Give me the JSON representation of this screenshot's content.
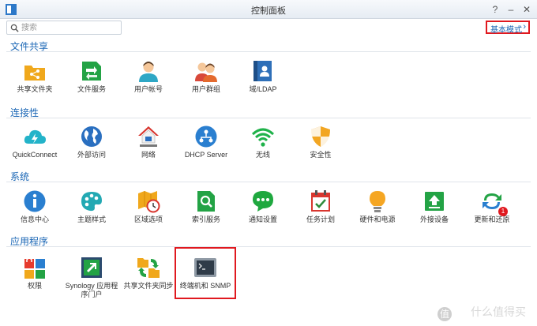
{
  "window": {
    "title": "控制面板",
    "help": "?",
    "minimize": "–",
    "close": "✕"
  },
  "search": {
    "placeholder": "搜索"
  },
  "mode_button": {
    "label": "基本模式",
    "chevron": "›"
  },
  "sections": [
    {
      "title": "文件共享",
      "items": [
        {
          "label": "共享文件夹",
          "icon": "share-folder-icon"
        },
        {
          "label": "文件服务",
          "icon": "file-services-icon"
        },
        {
          "label": "用户帐号",
          "icon": "user-icon"
        },
        {
          "label": "用户群组",
          "icon": "group-icon"
        },
        {
          "label": "域/LDAP",
          "icon": "ldap-icon"
        }
      ]
    },
    {
      "title": "连接性",
      "items": [
        {
          "label": "QuickConnect",
          "icon": "cloud-icon"
        },
        {
          "label": "外部访问",
          "icon": "globe-icon"
        },
        {
          "label": "网络",
          "icon": "network-house-icon"
        },
        {
          "label": "DHCP Server",
          "icon": "dhcp-icon"
        },
        {
          "label": "无线",
          "icon": "wifi-icon"
        },
        {
          "label": "安全性",
          "icon": "shield-icon"
        }
      ]
    },
    {
      "title": "系统",
      "items": [
        {
          "label": "信息中心",
          "icon": "info-icon"
        },
        {
          "label": "主题样式",
          "icon": "palette-icon"
        },
        {
          "label": "区域选项",
          "icon": "region-clock-icon"
        },
        {
          "label": "索引服务",
          "icon": "index-search-icon"
        },
        {
          "label": "通知设置",
          "icon": "chat-icon"
        },
        {
          "label": "任务计划",
          "icon": "calendar-check-icon"
        },
        {
          "label": "硬件和电源",
          "icon": "bulb-icon"
        },
        {
          "label": "外接设备",
          "icon": "upload-icon"
        },
        {
          "label": "更新和还原",
          "icon": "update-icon",
          "badge": "1"
        }
      ]
    },
    {
      "title": "应用程序",
      "items": [
        {
          "label": "权限",
          "icon": "privileges-icon"
        },
        {
          "label": "Synology 应用程序门户",
          "icon": "app-portal-icon"
        },
        {
          "label": "共享文件夹同步",
          "icon": "folder-sync-icon"
        },
        {
          "label": "终端机和 SNMP",
          "icon": "terminal-icon"
        }
      ]
    }
  ],
  "watermark": {
    "text": "什么值得买",
    "logo": "值"
  }
}
